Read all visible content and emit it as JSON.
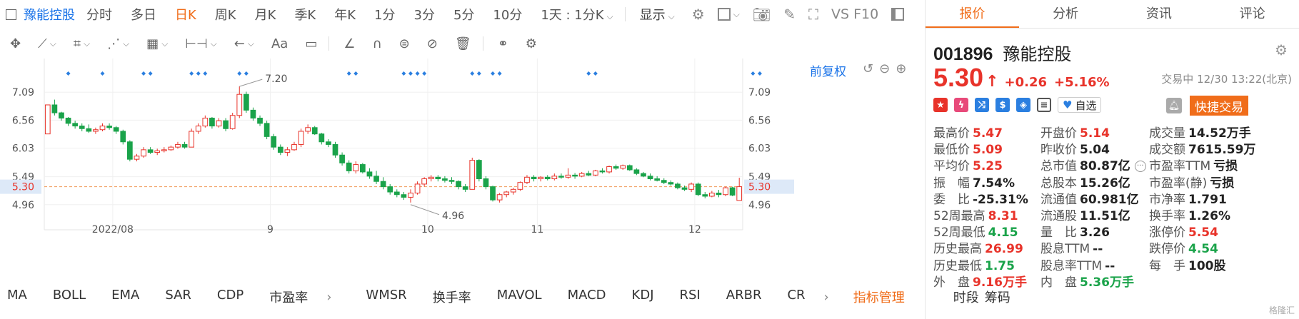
{
  "toolbar": {
    "stock_name": "豫能控股",
    "timeframes": [
      "分时",
      "多日",
      "日K",
      "周K",
      "月K",
      "季K",
      "年K",
      "1分",
      "3分",
      "5分",
      "10分"
    ],
    "active_timeframe": "日K",
    "interval_select": "1天 : 1分K",
    "display_label": "显示",
    "f10_label": "VS F10"
  },
  "chart_header": {
    "adjust_label": "前复权"
  },
  "indicators": {
    "items": [
      "MA",
      "BOLL",
      "EMA",
      "SAR",
      "CDP",
      "市盈率"
    ],
    "items2": [
      "WMSR",
      "换手率",
      "MAVOL",
      "MACD",
      "KDJ",
      "RSI",
      "ARBR",
      "CR"
    ],
    "manage_label": "指标管理",
    "period_label": "时段",
    "chip_label": "筹码"
  },
  "tabs": [
    "报价",
    "分析",
    "资讯",
    "评论"
  ],
  "quote": {
    "code": "001896",
    "name": "豫能控股",
    "price": "5.30",
    "change": "+0.26",
    "change_pct": "+5.16%",
    "status": "交易中 12/30 13:22(北京)",
    "watch_label": "自选",
    "quick_trade": "快捷交易"
  },
  "stats": [
    {
      "k": "最高价",
      "v": "5.47",
      "c": "red"
    },
    {
      "k": "开盘价",
      "v": "5.14",
      "c": "red"
    },
    {
      "k": "成交量",
      "v": "14.52万手",
      "c": "dark"
    },
    {
      "k": "最低价",
      "v": "5.09",
      "c": "red"
    },
    {
      "k": "昨收价",
      "v": "5.04",
      "c": "dark"
    },
    {
      "k": "成交额",
      "v": "7615.59万",
      "c": "dark"
    },
    {
      "k": "平均价",
      "v": "5.25",
      "c": "red"
    },
    {
      "k": "总市值",
      "v": "80.87亿",
      "c": "dark"
    },
    {
      "k": "市盈率TTM",
      "v": "亏损",
      "c": "dark"
    },
    {
      "k": "振　幅",
      "v": "7.54%",
      "c": "dark"
    },
    {
      "k": "总股本",
      "v": "15.26亿",
      "c": "dark"
    },
    {
      "k": "市盈率(静)",
      "v": "亏损",
      "c": "dark"
    },
    {
      "k": "委　比",
      "v": "-25.31%",
      "c": "dark"
    },
    {
      "k": "流通值",
      "v": "60.981亿",
      "c": "dark"
    },
    {
      "k": "市净率",
      "v": "1.791",
      "c": "dark"
    },
    {
      "k": "52周最高",
      "v": "8.31",
      "c": "red"
    },
    {
      "k": "流通股",
      "v": "11.51亿",
      "c": "dark"
    },
    {
      "k": "换手率",
      "v": "1.26%",
      "c": "dark"
    },
    {
      "k": "52周最低",
      "v": "4.15",
      "c": "green"
    },
    {
      "k": "量　比",
      "v": "3.26",
      "c": "dark"
    },
    {
      "k": "涨停价",
      "v": "5.54",
      "c": "red"
    },
    {
      "k": "历史最高",
      "v": "26.99",
      "c": "red"
    },
    {
      "k": "股息TTM",
      "v": "--",
      "c": "dark"
    },
    {
      "k": "跌停价",
      "v": "4.54",
      "c": "green"
    },
    {
      "k": "历史最低",
      "v": "1.75",
      "c": "green"
    },
    {
      "k": "股息率TTM",
      "v": "--",
      "c": "dark"
    },
    {
      "k": "每　手",
      "v": "100股",
      "c": "dark"
    },
    {
      "k": "外　盘",
      "v": "9.16万手",
      "c": "red"
    },
    {
      "k": "内　盘",
      "v": "5.36万手",
      "c": "green"
    }
  ],
  "watermark": "格隆汇",
  "colors": {
    "up": "#e8332a",
    "down": "#1aa34a",
    "accent": "#f06d1a",
    "link": "#1a73e8",
    "marker": "#2b7fe0"
  },
  "chart_data": {
    "type": "candlestick",
    "y_ticks": [
      "7.09",
      "6.56",
      "6.03",
      "5.49",
      "4.96"
    ],
    "y_tick_values": [
      7.09,
      6.56,
      6.03,
      5.49,
      4.96
    ],
    "ylim": [
      4.7,
      7.35
    ],
    "x_labels": [
      "2022/08",
      "9",
      "10",
      "11",
      "12"
    ],
    "x_label_index": [
      10,
      33,
      56,
      72,
      95
    ],
    "current_price": "5.30",
    "current_price_value": 5.3,
    "high_annotation": "7.20",
    "high_annotation_value": 7.2,
    "low_annotation": "4.96",
    "low_annotation_value": 4.96,
    "ohlc": [
      [
        6.3,
        6.85,
        6.3,
        6.85
      ],
      [
        6.85,
        6.95,
        6.65,
        6.7
      ],
      [
        6.7,
        6.72,
        6.55,
        6.6
      ],
      [
        6.6,
        6.62,
        6.45,
        6.5
      ],
      [
        6.5,
        6.55,
        6.4,
        6.45
      ],
      [
        6.45,
        6.5,
        6.35,
        6.4
      ],
      [
        6.4,
        6.48,
        6.32,
        6.35
      ],
      [
        6.35,
        6.42,
        6.3,
        6.38
      ],
      [
        6.38,
        6.5,
        6.35,
        6.45
      ],
      [
        6.45,
        6.5,
        6.38,
        6.42
      ],
      [
        6.42,
        6.45,
        6.3,
        6.35
      ],
      [
        6.35,
        6.38,
        6.1,
        6.15
      ],
      [
        6.15,
        6.18,
        5.78,
        5.82
      ],
      [
        5.82,
        5.92,
        5.78,
        5.88
      ],
      [
        5.88,
        6.05,
        5.85,
        6.0
      ],
      [
        6.0,
        6.05,
        5.92,
        5.95
      ],
      [
        5.95,
        6.02,
        5.9,
        5.98
      ],
      [
        5.98,
        6.05,
        5.95,
        6.0
      ],
      [
        6.0,
        6.08,
        5.98,
        6.05
      ],
      [
        6.05,
        6.15,
        6.02,
        6.1
      ],
      [
        6.1,
        6.15,
        6.02,
        6.05
      ],
      [
        6.05,
        6.4,
        6.05,
        6.35
      ],
      [
        6.35,
        6.5,
        6.3,
        6.45
      ],
      [
        6.45,
        6.65,
        6.42,
        6.6
      ],
      [
        6.6,
        6.62,
        6.4,
        6.45
      ],
      [
        6.45,
        6.6,
        6.42,
        6.55
      ],
      [
        6.55,
        6.6,
        6.35,
        6.4
      ],
      [
        6.4,
        6.7,
        6.38,
        6.65
      ],
      [
        6.65,
        7.2,
        6.6,
        7.05
      ],
      [
        7.05,
        7.1,
        6.7,
        6.75
      ],
      [
        6.75,
        6.8,
        6.55,
        6.6
      ],
      [
        6.6,
        6.65,
        6.45,
        6.5
      ],
      [
        6.5,
        6.55,
        6.2,
        6.25
      ],
      [
        6.25,
        6.3,
        6.0,
        6.05
      ],
      [
        6.05,
        6.1,
        5.9,
        5.95
      ],
      [
        5.95,
        6.05,
        5.88,
        6.0
      ],
      [
        6.0,
        6.15,
        5.98,
        6.1
      ],
      [
        6.1,
        6.4,
        6.05,
        6.35
      ],
      [
        6.35,
        6.48,
        6.3,
        6.42
      ],
      [
        6.42,
        6.45,
        6.28,
        6.3
      ],
      [
        6.3,
        6.32,
        6.1,
        6.15
      ],
      [
        6.15,
        6.2,
        6.05,
        6.1
      ],
      [
        6.1,
        6.15,
        5.85,
        5.9
      ],
      [
        5.9,
        5.95,
        5.7,
        5.75
      ],
      [
        5.75,
        5.8,
        5.55,
        5.6
      ],
      [
        5.6,
        5.78,
        5.55,
        5.72
      ],
      [
        5.72,
        5.75,
        5.55,
        5.58
      ],
      [
        5.58,
        5.65,
        5.45,
        5.5
      ],
      [
        5.5,
        5.6,
        5.35,
        5.4
      ],
      [
        5.4,
        5.48,
        5.25,
        5.3
      ],
      [
        5.3,
        5.35,
        5.15,
        5.2
      ],
      [
        5.2,
        5.25,
        5.1,
        5.15
      ],
      [
        5.15,
        5.2,
        5.05,
        5.1
      ],
      [
        5.1,
        5.25,
        5.0,
        5.18
      ],
      [
        5.18,
        5.4,
        5.15,
        5.35
      ],
      [
        5.35,
        5.48,
        5.3,
        5.45
      ],
      [
        5.45,
        5.52,
        5.4,
        5.48
      ],
      [
        5.48,
        5.52,
        5.4,
        5.45
      ],
      [
        5.45,
        5.5,
        5.38,
        5.42
      ],
      [
        5.42,
        5.48,
        5.35,
        5.4
      ],
      [
        5.4,
        5.42,
        5.25,
        5.3
      ],
      [
        5.3,
        5.35,
        5.2,
        5.25
      ],
      [
        5.25,
        5.85,
        5.25,
        5.8
      ],
      [
        5.8,
        5.82,
        5.4,
        5.45
      ],
      [
        5.45,
        5.5,
        5.25,
        5.3
      ],
      [
        5.3,
        5.32,
        5.02,
        5.05
      ],
      [
        5.05,
        5.18,
        5.0,
        5.15
      ],
      [
        5.15,
        5.22,
        5.1,
        5.2
      ],
      [
        5.2,
        5.28,
        5.15,
        5.25
      ],
      [
        5.25,
        5.4,
        5.22,
        5.38
      ],
      [
        5.38,
        5.52,
        5.35,
        5.48
      ],
      [
        5.48,
        5.52,
        5.4,
        5.45
      ],
      [
        5.45,
        5.5,
        5.4,
        5.48
      ],
      [
        5.48,
        5.52,
        5.42,
        5.45
      ],
      [
        5.45,
        5.55,
        5.42,
        5.5
      ],
      [
        5.5,
        5.55,
        5.45,
        5.48
      ],
      [
        5.48,
        5.65,
        5.45,
        5.52
      ],
      [
        5.52,
        5.56,
        5.45,
        5.5
      ],
      [
        5.5,
        5.58,
        5.48,
        5.55
      ],
      [
        5.55,
        5.6,
        5.5,
        5.52
      ],
      [
        5.52,
        5.62,
        5.5,
        5.6
      ],
      [
        5.6,
        5.65,
        5.55,
        5.58
      ],
      [
        5.58,
        5.7,
        5.55,
        5.68
      ],
      [
        5.68,
        5.72,
        5.62,
        5.65
      ],
      [
        5.65,
        5.72,
        5.62,
        5.7
      ],
      [
        5.7,
        5.72,
        5.6,
        5.62
      ],
      [
        5.62,
        5.65,
        5.52,
        5.55
      ],
      [
        5.55,
        5.58,
        5.48,
        5.5
      ],
      [
        5.5,
        5.55,
        5.42,
        5.45
      ],
      [
        5.45,
        5.5,
        5.4,
        5.42
      ],
      [
        5.42,
        5.46,
        5.35,
        5.38
      ],
      [
        5.38,
        5.42,
        5.32,
        5.35
      ],
      [
        5.35,
        5.38,
        5.25,
        5.28
      ],
      [
        5.28,
        5.32,
        5.22,
        5.25
      ],
      [
        5.25,
        5.38,
        5.2,
        5.35
      ],
      [
        5.35,
        5.38,
        5.12,
        5.15
      ],
      [
        5.15,
        5.2,
        5.08,
        5.12
      ],
      [
        5.12,
        5.22,
        5.1,
        5.18
      ],
      [
        5.18,
        5.24,
        5.1,
        5.15
      ],
      [
        5.15,
        5.3,
        5.12,
        5.28
      ],
      [
        5.28,
        5.3,
        5.12,
        5.14
      ],
      [
        5.04,
        5.47,
        5.09,
        5.3
      ]
    ],
    "marker_index": [
      3,
      8,
      14,
      15,
      21,
      22,
      23,
      28,
      29,
      44,
      45,
      52,
      53,
      54,
      55,
      62,
      63,
      65,
      66,
      79,
      80,
      103,
      104
    ]
  }
}
